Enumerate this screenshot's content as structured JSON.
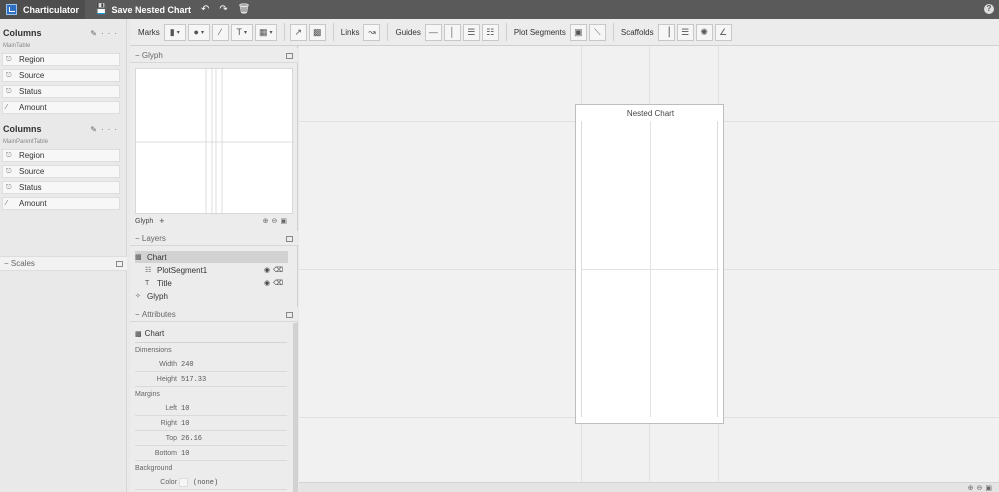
{
  "app": {
    "name": "Charticulator",
    "save_label": "Save Nested Chart",
    "undo_icon": "undo-icon",
    "redo_icon": "redo-icon",
    "trash_icon": "trash-icon",
    "help_label": "?"
  },
  "toolbar": {
    "marks_label": "Marks",
    "links_label": "Links",
    "guides_label": "Guides",
    "plot_segments_label": "Plot Segments",
    "scaffolds_label": "Scaffolds"
  },
  "data_panel": {
    "tables": [
      {
        "title": "Columns",
        "table_name": "MainTable",
        "fields": [
          {
            "label": "Region",
            "icon": "categorical-icon"
          },
          {
            "label": "Source",
            "icon": "categorical-icon"
          },
          {
            "label": "Status",
            "icon": "categorical-icon"
          },
          {
            "label": "Amount",
            "icon": "numeric-icon"
          }
        ]
      },
      {
        "title": "Columns",
        "table_name": "MainParentTable",
        "fields": [
          {
            "label": "Region",
            "icon": "categorical-icon"
          },
          {
            "label": "Source",
            "icon": "categorical-icon"
          },
          {
            "label": "Status",
            "icon": "categorical-icon"
          },
          {
            "label": "Amount",
            "icon": "numeric-icon"
          }
        ]
      }
    ],
    "scales_label": "Scales"
  },
  "glyph_panel": {
    "header": "Glyph",
    "footer_label": "Glyph",
    "add_label": "+"
  },
  "layers_panel": {
    "header": "Layers",
    "items": [
      {
        "label": "Chart",
        "icon": "chart-icon"
      },
      {
        "label": "PlotSegment1",
        "icon": "plot-segment-icon"
      },
      {
        "label": "Title",
        "icon": "text-icon"
      },
      {
        "label": "Glyph",
        "icon": "glyph-icon"
      }
    ]
  },
  "attributes_panel": {
    "header": "Attributes",
    "object_name": "Chart",
    "groups": {
      "dimensions": "Dimensions",
      "margins": "Margins",
      "background": "Background"
    },
    "width_label": "Width",
    "width_value": "240",
    "height_label": "Height",
    "height_value": "517.33",
    "left_label": "Left",
    "left_value": "10",
    "right_label": "Right",
    "right_value": "10",
    "top_label": "Top",
    "top_value": "26.16",
    "bottom_label": "Bottom",
    "bottom_value": "10",
    "color_label": "Color",
    "color_value": "(none)"
  },
  "canvas": {
    "chart_title": "Nested Chart"
  },
  "colors": {
    "titlebar_bg": "#5a5a5a",
    "panel_bg": "#ececec",
    "canvas_bg": "#f1f1f1",
    "selection_bg": "#d2d2d2"
  }
}
